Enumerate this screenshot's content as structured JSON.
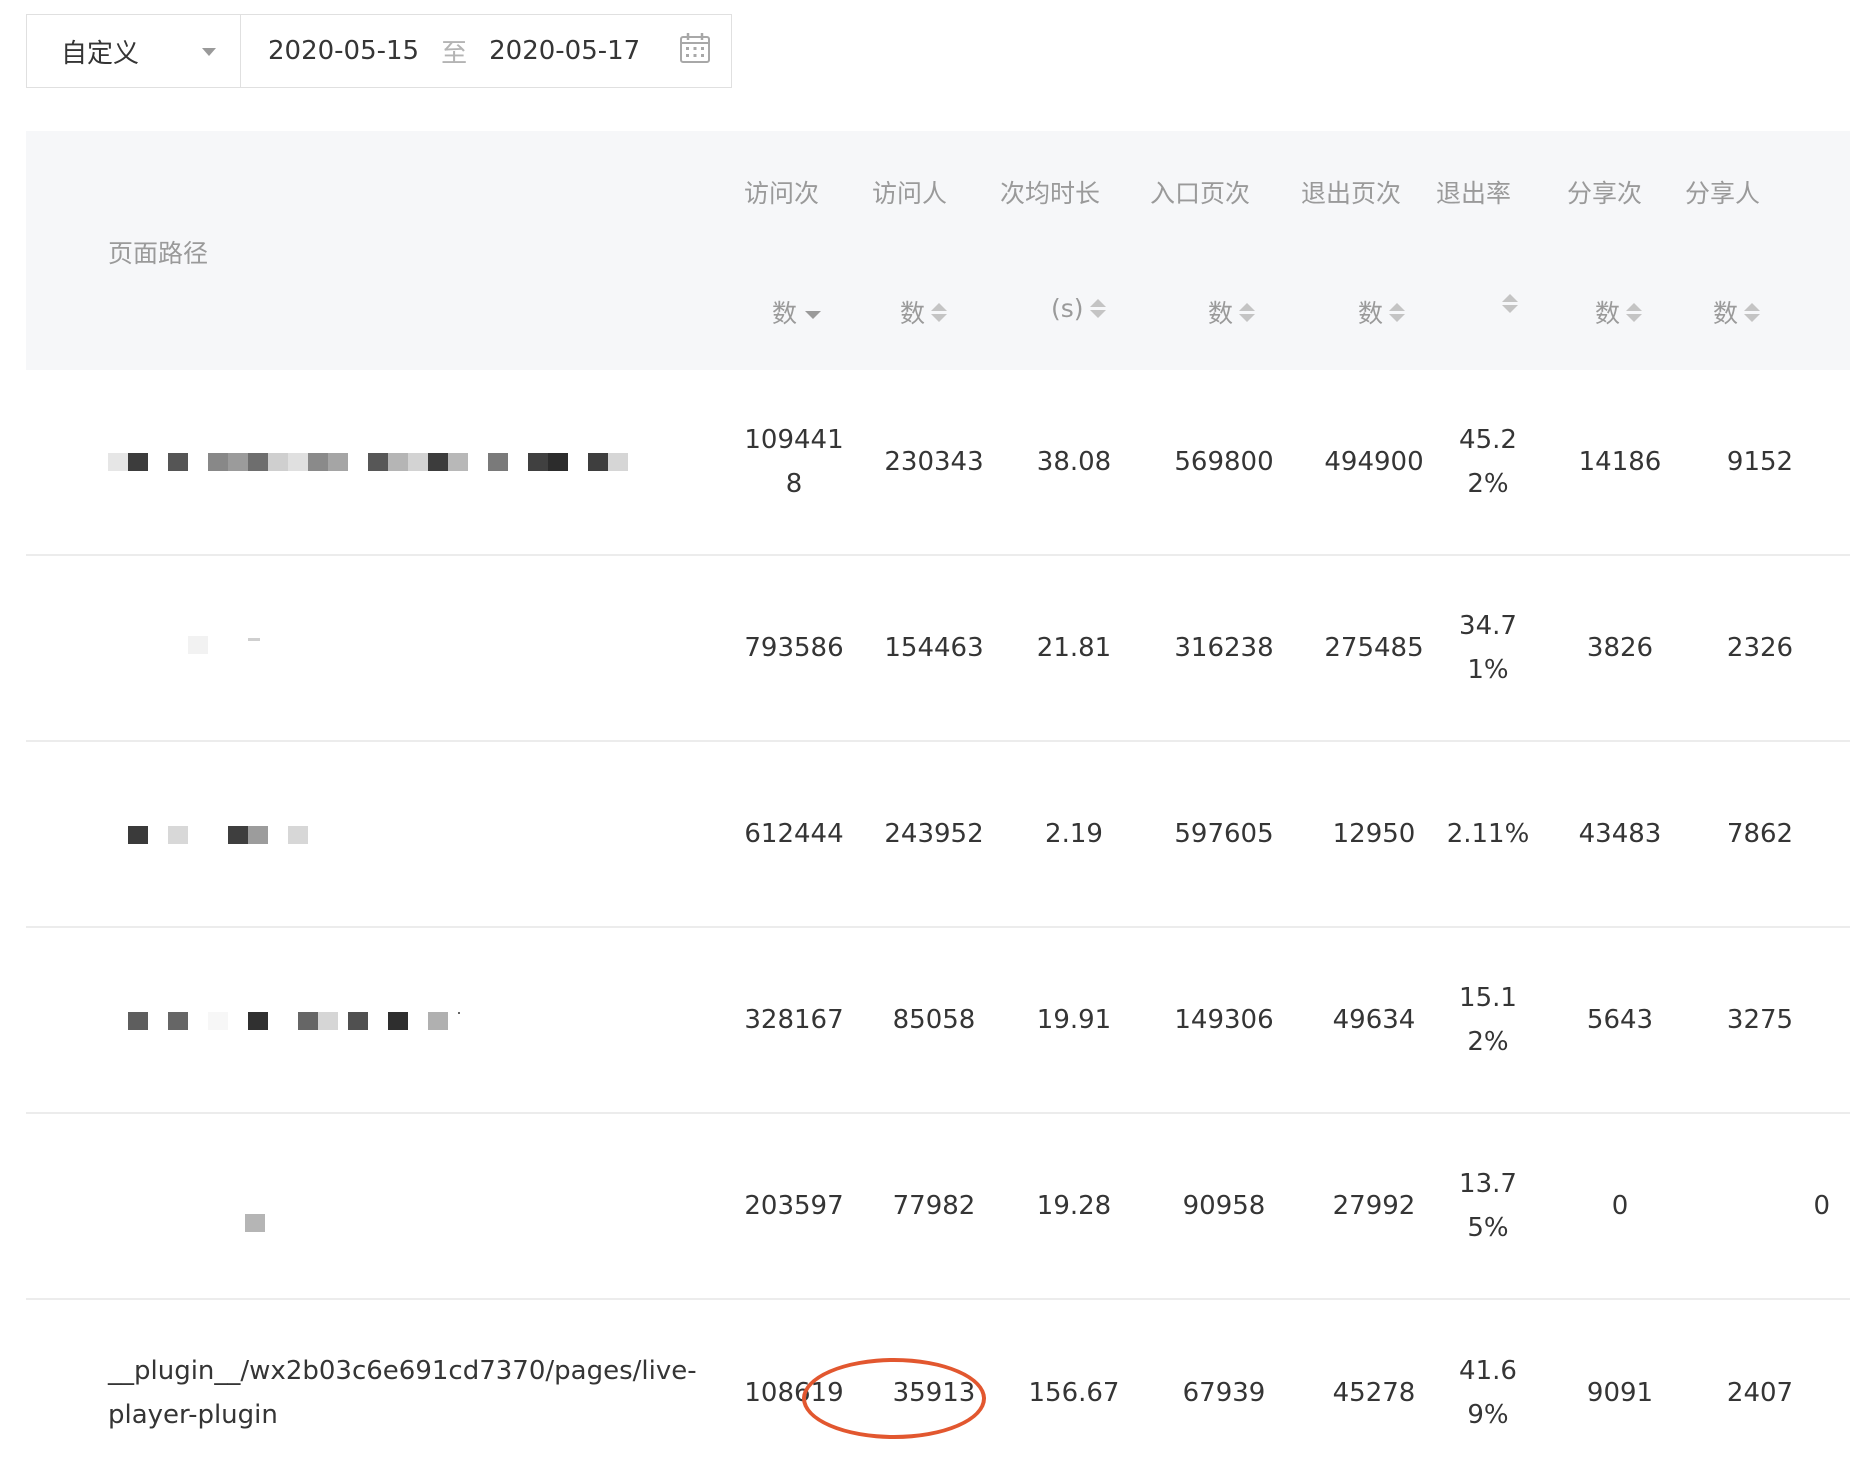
{
  "filter": {
    "range_label": "自定义",
    "start_date": "2020-05-15",
    "separator": "至",
    "end_date": "2020-05-17"
  },
  "table": {
    "headers": {
      "path": "页面路径",
      "visits_l1": "访问次",
      "visits_l2": "数",
      "visitors_l1": "访问人",
      "visitors_l2": "数",
      "avg_l1": "次均时长",
      "avg_l2": "(s)",
      "entry_l1": "入口页次",
      "entry_l2": "数",
      "exit_l1": "退出页次",
      "exit_l2": "数",
      "exitrate_l1": "退出率",
      "share_l1": "分享次",
      "share_l2": "数",
      "sharers_l1": "分享人",
      "sharers_l2": "数"
    },
    "rows": [
      {
        "path": "",
        "visits_a": "109441",
        "visits_b": "8",
        "visitors": "230343",
        "avg": "38.08",
        "entry": "569800",
        "exit": "494900",
        "rate_a": "45.2",
        "rate_b": "2%",
        "shares": "14186",
        "sharers": "9152"
      },
      {
        "path": "",
        "visits_a": "793586",
        "visits_b": "",
        "visitors": "154463",
        "avg": "21.81",
        "entry": "316238",
        "exit": "275485",
        "rate_a": "34.7",
        "rate_b": "1%",
        "shares": "3826",
        "sharers": "2326"
      },
      {
        "path": "",
        "visits_a": "612444",
        "visits_b": "",
        "visitors": "243952",
        "avg": "2.19",
        "entry": "597605",
        "exit": "12950",
        "rate_a": "2.11%",
        "rate_b": "",
        "shares": "43483",
        "sharers": "7862"
      },
      {
        "path": "",
        "visits_a": "328167",
        "visits_b": "",
        "visitors": "85058",
        "avg": "19.91",
        "entry": "149306",
        "exit": "49634",
        "rate_a": "15.1",
        "rate_b": "2%",
        "shares": "5643",
        "sharers": "3275"
      },
      {
        "path": "",
        "visits_a": "203597",
        "visits_b": "",
        "visitors": "77982",
        "avg": "19.28",
        "entry": "90958",
        "exit": "27992",
        "rate_a": "13.7",
        "rate_b": "5%",
        "shares": "0",
        "sharers": "0"
      },
      {
        "path_a": "__plugin__/wx2b03c6e691cd7370/pages/live-",
        "path_b": "player-plugin",
        "visits_a": "108619",
        "visits_b": "",
        "visitors": "35913",
        "avg": "156.67",
        "entry": "67939",
        "exit": "45278",
        "rate_a": "41.6",
        "rate_b": "9%",
        "shares": "9091",
        "sharers": "2407"
      }
    ]
  },
  "colors": {
    "header_bg": "#f6f7f9",
    "highlight": "#e2572f"
  }
}
